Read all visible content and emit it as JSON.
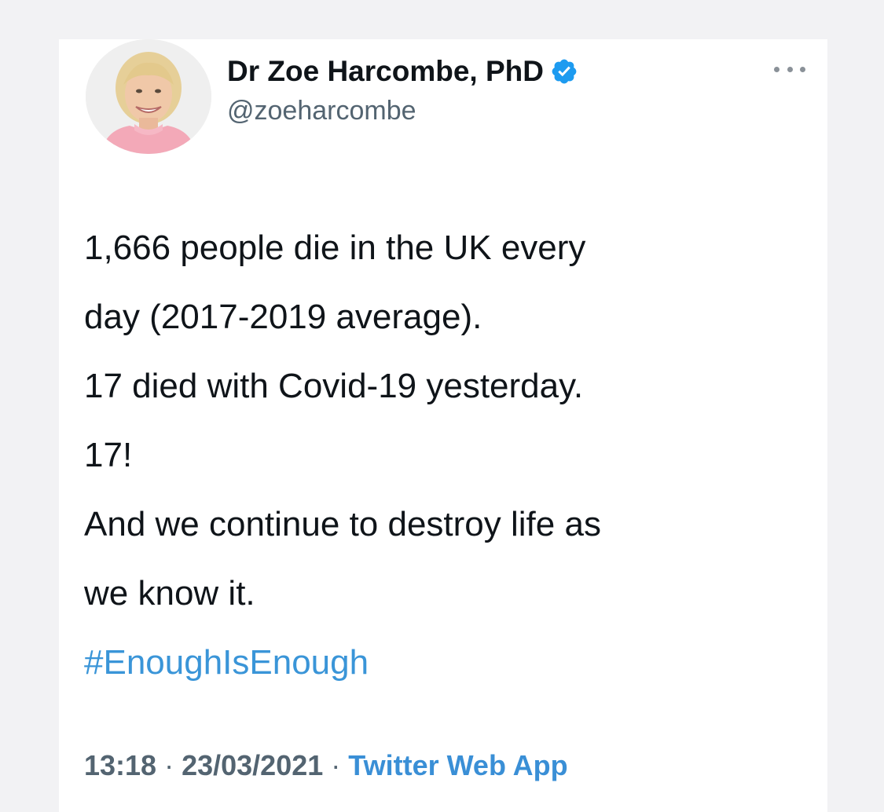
{
  "tweet": {
    "author": {
      "display_name": "Dr Zoe Harcombe, PhD",
      "handle": "@zoeharcombe",
      "verified_icon": "verified-badge-icon",
      "avatar_icon": "profile-photo"
    },
    "more_icon": "more-options-icon",
    "lines": [
      "1,666 people die in the UK every",
      "day (2017-2019 average).",
      "17 died with Covid-19 yesterday.",
      "17!",
      "And we continue to destroy life as",
      "we know it."
    ],
    "hashtag": "#EnoughIsEnough",
    "time": "13:18",
    "separator": " · ",
    "date": "23/03/2021",
    "source": "Twitter Web App",
    "colors": {
      "link": "#3a95d8",
      "verified": "#1d9bf0",
      "text": "#0f1419",
      "muted": "#536471"
    }
  }
}
